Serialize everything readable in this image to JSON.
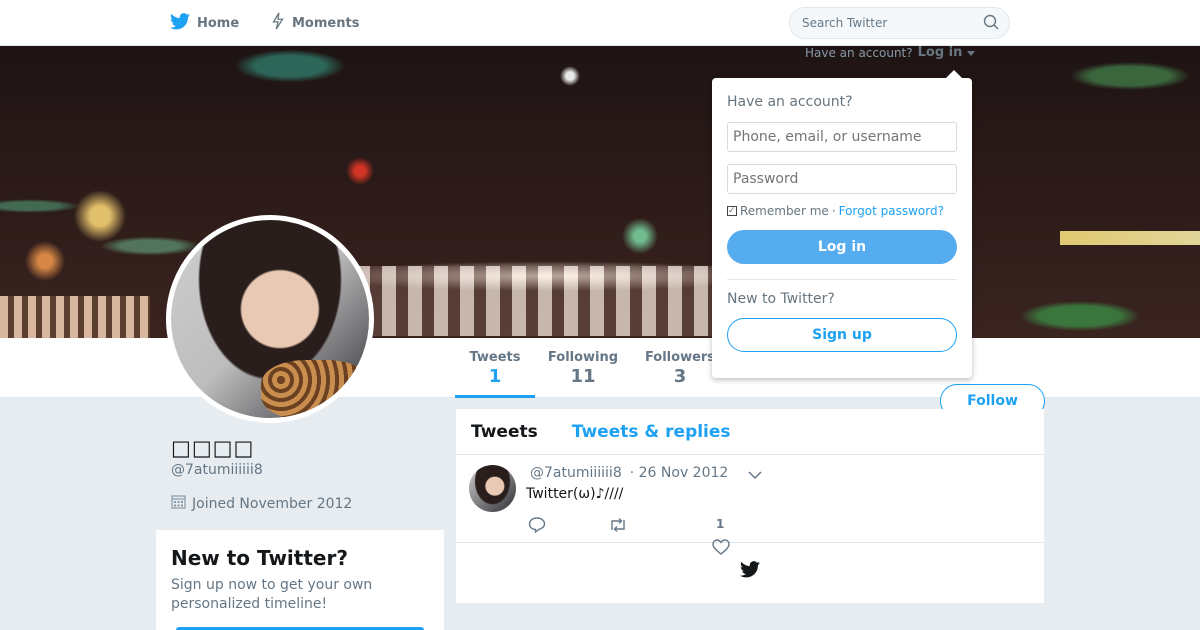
{
  "nav": {
    "home_label": "Home",
    "moments_label": "Moments",
    "search_placeholder": "Search Twitter"
  },
  "account_prompt": {
    "text": "Have an account?",
    "login_link": "Log in"
  },
  "profile": {
    "name": "□□□□",
    "handle": "@7atumiiiiii8",
    "joined": "Joined November 2012"
  },
  "stats": [
    {
      "label": "Tweets",
      "value": "1"
    },
    {
      "label": "Following",
      "value": "11"
    },
    {
      "label": "Followers",
      "value": "3"
    }
  ],
  "follow_label": "Follow",
  "signup_card": {
    "title": "New to Twitter?",
    "text": "Sign up now to get your own personalized timeline!"
  },
  "timeline": {
    "tabs": [
      "Tweets",
      "Tweets & replies"
    ],
    "tweet": {
      "handle": "@7atumiiiiii8",
      "date": "· 26 Nov 2012",
      "text": "Twitter(ω)♪////",
      "likes": "1"
    }
  },
  "login_dropdown": {
    "title": "Have an account?",
    "username_placeholder": "Phone, email, or username",
    "password_placeholder": "Password",
    "remember_me": "Remember me",
    "separator": "·",
    "forgot_password": "Forgot password?",
    "login_button": "Log in",
    "new_to_twitter": "New to Twitter?",
    "signup_button": "Sign up"
  },
  "colors": {
    "accent": "#1da1f2",
    "login_button": "#55acee",
    "page_background": "#e6ecf0"
  }
}
